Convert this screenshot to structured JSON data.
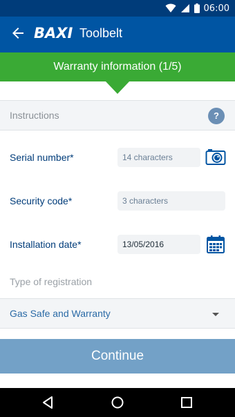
{
  "status_bar": {
    "time": "06:00"
  },
  "app_bar": {
    "brand": "BAXI",
    "title": "Toolbelt"
  },
  "step_banner": {
    "text": "Warranty information (1/5)"
  },
  "instructions": {
    "label": "Instructions",
    "help": "?"
  },
  "fields": [
    {
      "label": "Serial number*",
      "placeholder": "14 characters",
      "icon": "camera-icon"
    },
    {
      "label": "Security code*",
      "placeholder": "3 characters"
    },
    {
      "label": "Installation date*",
      "value": "13/05/2016",
      "icon": "calendar-icon"
    }
  ],
  "registration": {
    "label": "Type of registration",
    "selected": "Gas Safe and Warranty"
  },
  "continue_label": "Continue",
  "colors": {
    "primary": "#0055a3",
    "status": "#003c7a",
    "banner": "#3aaa35",
    "button": "#73a1c7"
  }
}
